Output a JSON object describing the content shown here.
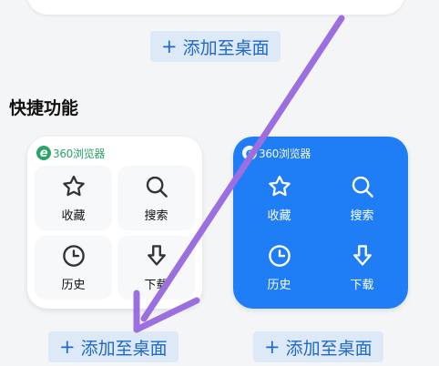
{
  "top_add_button": {
    "plus": "+",
    "label": "添加至桌面"
  },
  "section": {
    "title": "快捷功能"
  },
  "widgets": [
    {
      "brand": "360浏览器",
      "style": "light",
      "items": [
        {
          "label": "收藏",
          "icon": "star-icon"
        },
        {
          "label": "搜索",
          "icon": "search-icon"
        },
        {
          "label": "历史",
          "icon": "clock-icon"
        },
        {
          "label": "下载",
          "icon": "download-icon"
        }
      ],
      "add_button": {
        "plus": "+",
        "label": "添加至桌面"
      }
    },
    {
      "brand": "360浏览器",
      "style": "blue",
      "items": [
        {
          "label": "收藏",
          "icon": "star-icon"
        },
        {
          "label": "搜索",
          "icon": "search-icon"
        },
        {
          "label": "历史",
          "icon": "clock-icon"
        },
        {
          "label": "下载",
          "icon": "download-icon"
        }
      ],
      "add_button": {
        "plus": "+",
        "label": "添加至桌面"
      }
    }
  ],
  "colors": {
    "accent_blue": "#1f7ef5",
    "button_bg": "#dde9f7",
    "button_text": "#1f69c9",
    "brand_green": "#2aa56a",
    "annotation_arrow": "#9b6fe0"
  }
}
